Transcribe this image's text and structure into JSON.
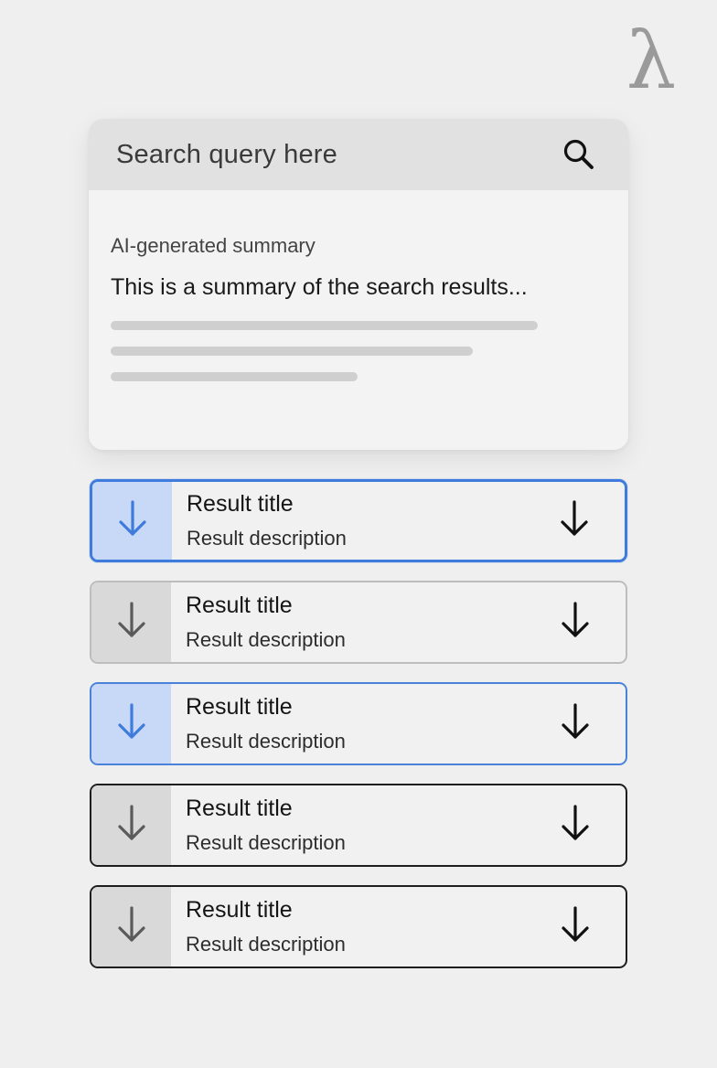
{
  "logo": {
    "glyph": "λ"
  },
  "search": {
    "query": "Search query here",
    "icon": "search-icon"
  },
  "summary": {
    "label": "AI-generated summary",
    "text": "This is a summary of the search results..."
  },
  "results": [
    {
      "title": "Result title",
      "description": "Result description",
      "state": "selected",
      "icon": "arrow-down-icon"
    },
    {
      "title": "Result title",
      "description": "Result description",
      "state": "disabled",
      "icon": "arrow-down-icon"
    },
    {
      "title": "Result title",
      "description": "Result description",
      "state": "highlighted",
      "icon": "arrow-down-icon"
    },
    {
      "title": "Result title",
      "description": "Result description",
      "state": "default",
      "icon": "arrow-down-icon"
    },
    {
      "title": "Result title",
      "description": "Result description",
      "state": "default",
      "icon": "arrow-down-icon"
    }
  ],
  "colors": {
    "accent": "#3f7bdc",
    "accent_light": "#c7d9f7",
    "neutral_side": "#d9d9d9",
    "background": "#efefef"
  }
}
